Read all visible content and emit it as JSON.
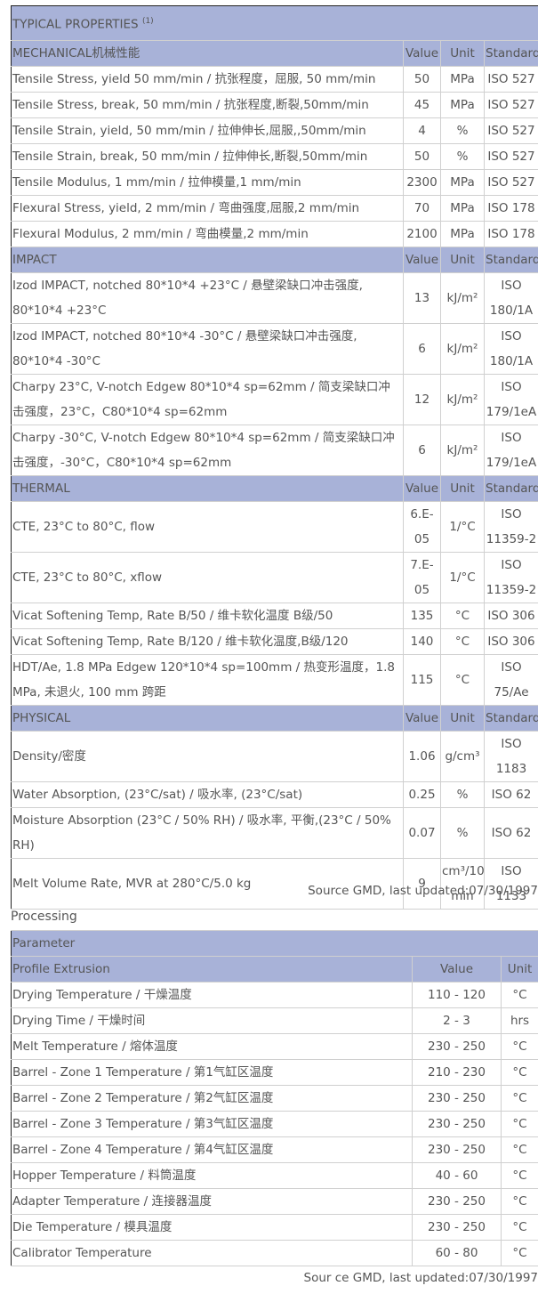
{
  "properties": {
    "title": "TYPICAL PROPERTIES",
    "title_sup": "(1)",
    "sections": [
      {
        "name": "MECHANICAL机械性能",
        "headers": [
          "Value",
          "Unit",
          "Standard"
        ],
        "rows": [
          {
            "label": "Tensile Stress, yield 50 mm/min / 抗张程度，屈服, 50 mm/min",
            "value": "50",
            "unit": "MPa",
            "std": "ISO 527"
          },
          {
            "label": "Tensile Stress, break, 50 mm/min / 抗张程度,断裂,50mm/min",
            "value": "45",
            "unit": "MPa",
            "std": "ISO 527"
          },
          {
            "label": "Tensile Strain, yield, 50 mm/min / 拉伸伸长,屈服,,50mm/min",
            "value": "4",
            "unit": "%",
            "std": "ISO 527"
          },
          {
            "label": "Tensile Strain, break, 50 mm/min / 拉伸伸长,断裂,50mm/min",
            "value": "50",
            "unit": "%",
            "std": "ISO 527"
          },
          {
            "label": "Tensile Modulus, 1 mm/min / 拉伸模量,1 mm/min",
            "value": "2300",
            "unit": "MPa",
            "std": "ISO 527"
          },
          {
            "label": "Flexural Stress, yield, 2 mm/min / 弯曲强度,屈服,2 mm/min",
            "value": "70",
            "unit": "MPa",
            "std": "ISO 178"
          },
          {
            "label": "Flexural Modulus, 2 mm/min / 弯曲模量,2 mm/min",
            "value": "2100",
            "unit": "MPa",
            "std": "ISO 178"
          }
        ]
      },
      {
        "name": "IMPACT",
        "headers": [
          "Value",
          "Unit",
          "Standard"
        ],
        "rows": [
          {
            "label": "Izod IMPACT, notched 80*10*4 +23°C / 悬壁梁缺口冲击强度, 80*10*4 +23°C",
            "value": "13",
            "unit": "kJ/m²",
            "std": "ISO 180/1A"
          },
          {
            "label": "Izod IMPACT, notched 80*10*4 -30°C / 悬壁梁缺口冲击强度, 80*10*4 -30°C",
            "value": "6",
            "unit": "kJ/m²",
            "std": "ISO 180/1A"
          },
          {
            "label": "Charpy 23°C, V-notch Edgew 80*10*4 sp=62mm / 简支梁缺口冲击强度，23°C，C80*10*4 sp=62mm",
            "value": "12",
            "unit": "kJ/m²",
            "std": "ISO 179/1eA"
          },
          {
            "label": "Charpy -30°C, V-notch Edgew 80*10*4 sp=62mm / 简支梁缺口冲击强度，-30°C，C80*10*4 sp=62mm",
            "value": "6",
            "unit": "kJ/m²",
            "std": "ISO 179/1eA"
          }
        ]
      },
      {
        "name": "THERMAL",
        "headers": [
          "Value",
          "Unit",
          "Standard"
        ],
        "rows": [
          {
            "label": "CTE, 23°C to 80°C, flow",
            "value": "6.E-05",
            "unit": "1/°C",
            "std": "ISO 11359-2"
          },
          {
            "label": "CTE, 23°C to 80°C, xflow",
            "value": "7.E-05",
            "unit": "1/°C",
            "std": "ISO 11359-2"
          },
          {
            "label": "Vicat Softening Temp, Rate B/50 / 维卡软化温度 B级/50",
            "value": "135",
            "unit": "°C",
            "std": "ISO 306"
          },
          {
            "label": "Vicat Softening Temp, Rate B/120 / 维卡软化温度,B级/120",
            "value": "140",
            "unit": "°C",
            "std": "ISO 306"
          },
          {
            "label": "HDT/Ae, 1.8 MPa Edgew 120*10*4 sp=100mm / 热变形温度，1.8 MPa, 未退火, 100 mm 跨距",
            "value": "115",
            "unit": "°C",
            "std": "ISO 75/Ae"
          }
        ]
      },
      {
        "name": "PHYSICAL",
        "headers": [
          "Value",
          "Unit",
          "Standard"
        ],
        "rows": [
          {
            "label": "Density/密度",
            "value": "1.06",
            "unit": "g/cm³",
            "std": "ISO 1183"
          },
          {
            "label": "Water Absorption, (23°C/sat) / 吸水率, (23°C/sat)",
            "value": "0.25",
            "unit": "%",
            "std": "ISO 62"
          },
          {
            "label": "Moisture Absorption (23°C / 50% RH) / 吸水率, 平衡,(23°C / 50% RH)",
            "value": "0.07",
            "unit": "%",
            "std": "ISO 62"
          },
          {
            "label": "Melt Volume Rate, MVR at 280°C/5.0 kg",
            "value": "9",
            "unit": "cm³/10 min",
            "std": "ISO 1133"
          }
        ]
      }
    ],
    "source": "Source GMD, last updated:07/30/1997"
  },
  "processing": {
    "title": "Processing",
    "table_header": "Parameter",
    "section": "Profile Extrusion",
    "headers": [
      "Value",
      "Unit"
    ],
    "rows": [
      {
        "label": "Drying Temperature / 干燥温度",
        "value": "110 - 120",
        "unit": "°C"
      },
      {
        "label": "Drying Time / 干燥时间",
        "value": "2 - 3",
        "unit": "hrs"
      },
      {
        "label": "Melt Temperature / 熔体温度",
        "value": "230 - 250",
        "unit": "°C"
      },
      {
        "label": "Barrel - Zone 1 Temperature / 第1气缸区温度",
        "value": "210 - 230",
        "unit": "°C"
      },
      {
        "label": "Barrel - Zone 2 Temperature / 第2气缸区温度",
        "value": "230 - 250",
        "unit": "°C"
      },
      {
        "label": "Barrel - Zone 3 Temperature / 第3气缸区温度",
        "value": "230 - 250",
        "unit": "°C"
      },
      {
        "label": "Barrel - Zone 4 Temperature / 第4气缸区温度",
        "value": "230 - 250",
        "unit": "°C"
      },
      {
        "label": "Hopper Temperature / 料筒温度",
        "value": "40 - 60",
        "unit": "°C"
      },
      {
        "label": "Adapter Temperature / 连接器温度",
        "value": "230 - 250",
        "unit": "°C"
      },
      {
        "label": "Die Temperature / 模具温度",
        "value": "230 - 250",
        "unit": "°C"
      },
      {
        "label": "Calibrator Temperature",
        "value": "60 - 80",
        "unit": "°C"
      }
    ],
    "source": "Sour ce GMD, last updated:07/30/1997"
  }
}
